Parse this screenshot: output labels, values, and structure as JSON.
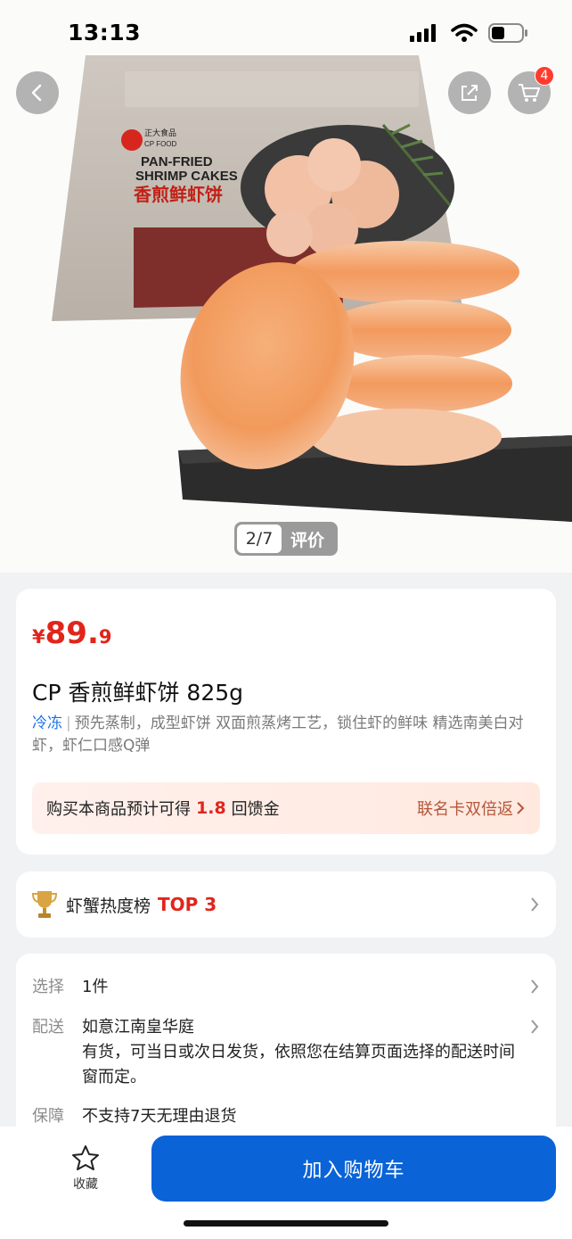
{
  "status": {
    "time": "13:13",
    "battery_color": "#000000"
  },
  "hero": {
    "pager_count": "2/7",
    "pager_label": "评价",
    "cart_badge": "4",
    "package_brand": "正大食品 CP FOOD",
    "package_title_en": "PAN-FRIED SHRIMP CAKES",
    "package_title_cn": "香煎鲜虾饼"
  },
  "product": {
    "price_currency": "¥",
    "price_int": "89.",
    "price_dec": "9",
    "title": "CP 香煎鲜虾饼 825g",
    "tag": "冷冻",
    "desc": "预先蒸制，成型虾饼 双面煎蒸烤工艺，锁住虾的鲜味 精选南美白对虾，虾仁口感Q弹",
    "rebate_text": "购买本商品预计可得",
    "rebate_amount": "1.8",
    "rebate_unit": "回馈金",
    "rebate_link": "联名卡双倍返"
  },
  "ranking": {
    "label": "虾蟹热度榜",
    "top": "TOP 3"
  },
  "spec": {
    "select_key": "选择",
    "select_val": "1件",
    "delivery_key": "配送",
    "delivery_addr": "如意江南皇华庭",
    "delivery_note": "有货，可当日或次日发货，依照您在结算页面选择的配送时间窗而定。",
    "guarantee_key": "保障",
    "guarantee_val": "不支持7天无理由退货"
  },
  "bottom": {
    "fav_label": "收藏",
    "add_cart_label": "加入购物车"
  },
  "colors": {
    "accent_red": "#e1251b",
    "primary_blue": "#0a63d7",
    "tag_blue": "#1a73e8"
  }
}
